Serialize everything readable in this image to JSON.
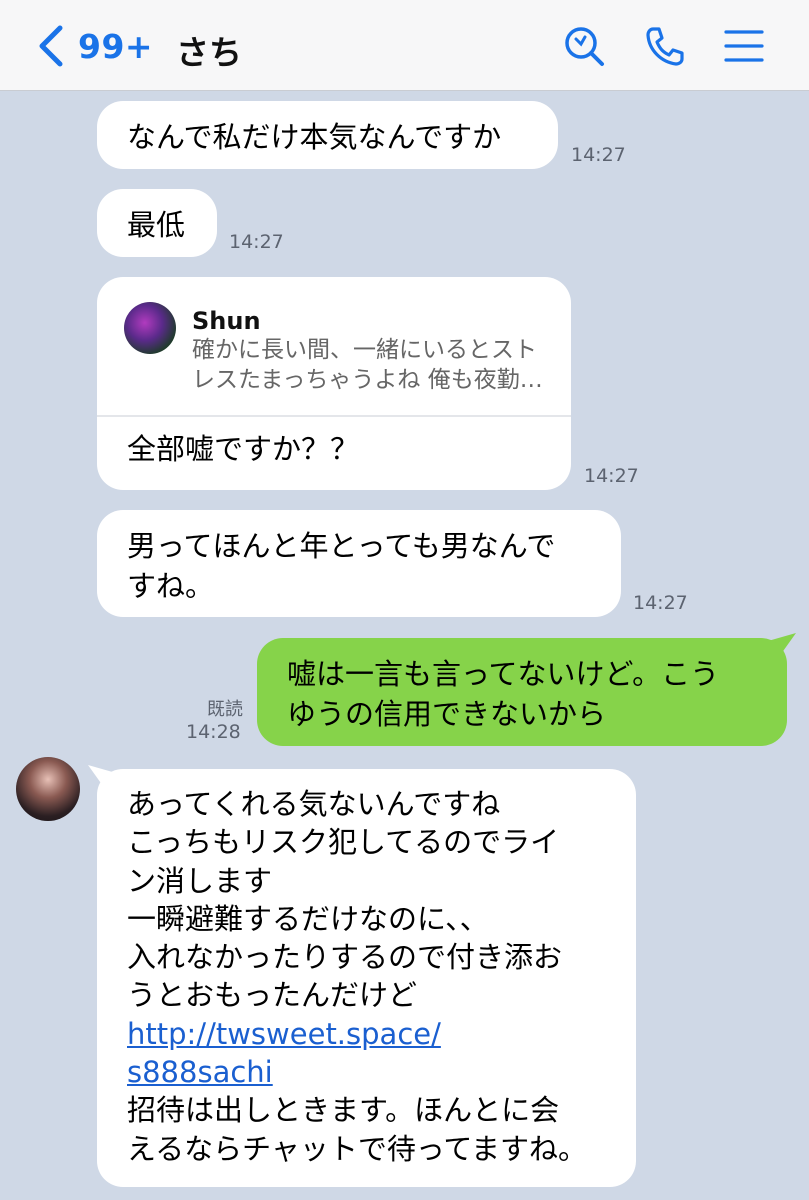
{
  "header": {
    "back_count": "99+",
    "title": "さち"
  },
  "messages": {
    "m1": {
      "text": "なんで私だけ本気なんですか",
      "time": "14:27"
    },
    "m2": {
      "text": "最低",
      "time": "14:27"
    },
    "m3": {
      "reply_name": "Shun",
      "reply_line1": "確かに長い間、一緒にいるとスト",
      "reply_line2": "レスたまっちゃうよね 俺も夜勤…",
      "text": "全部嘘ですか？？",
      "time": "14:27"
    },
    "m4": {
      "line1": "男ってほんと年とっても男なんで",
      "line2": "すね。",
      "time": "14:27"
    },
    "m5": {
      "line1": "嘘は一言も言ってないけど。こう",
      "line2": "ゆうの信用できないから",
      "read": "既読",
      "time": "14:28"
    },
    "m6": {
      "l1": "あってくれる気ないんですね",
      "l2": "こっちもリスク犯してるのでライ",
      "l3": "ン消します",
      "l4": "一瞬避難するだけなのに、、",
      "l5": "入れなかったりするので付き添お",
      "l6": "うとおもったんだけど",
      "link1": "http://twsweet.space/",
      "link2": "s888sachi",
      "l7": "招待は出しときます。ほんとに会",
      "l8": "えるならチャットで待ってますね。"
    }
  },
  "colors": {
    "accent": "#1a73e8",
    "my_bubble": "#86d34a",
    "background": "#cfd8e6"
  },
  "icons": [
    "back-chevron-icon",
    "search-icon",
    "phone-icon",
    "menu-icon"
  ]
}
